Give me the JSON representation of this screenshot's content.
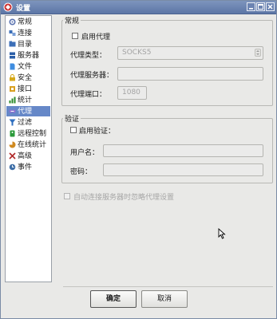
{
  "window": {
    "title": "设置"
  },
  "nav": {
    "items": [
      {
        "label": "常规",
        "icon": "gear-icon",
        "color": "#5a73b0"
      },
      {
        "label": "连接",
        "icon": "connection-icon",
        "color": "#3c6fb8"
      },
      {
        "label": "目录",
        "icon": "directory-icon",
        "color": "#3c6fb8"
      },
      {
        "label": "服务器",
        "icon": "server-icon",
        "color": "#2a5ea8"
      },
      {
        "label": "文件",
        "icon": "file-icon",
        "color": "#3f8de0"
      },
      {
        "label": "安全",
        "icon": "lock-icon",
        "color": "#d6a818"
      },
      {
        "label": "接口",
        "icon": "interface-icon",
        "color": "#d9a020"
      },
      {
        "label": "统计",
        "icon": "stats-icon",
        "color": "#2a8a2a"
      },
      {
        "label": "代理",
        "icon": "proxy-icon",
        "color": "#8e6fd0"
      },
      {
        "label": "过滤",
        "icon": "filter-icon",
        "color": "#3070c0"
      },
      {
        "label": "远程控制",
        "icon": "remote-control-icon",
        "color": "#2a9a3a"
      },
      {
        "label": "在线统计",
        "icon": "online-stats-icon",
        "color": "#d08a20"
      },
      {
        "label": "高级",
        "icon": "advanced-icon",
        "color": "#b02828"
      },
      {
        "label": "事件",
        "icon": "event-icon",
        "color": "#4070a8"
      }
    ],
    "selected_index": 8
  },
  "general": {
    "title": "常规",
    "enable_proxy": "启用代理",
    "proxy_type_label": "代理类型：",
    "proxy_type_value": "SOCKS5",
    "proxy_server_label": "代理服务器：",
    "proxy_server_value": "",
    "proxy_port_label": "代理端口：",
    "proxy_port_value": "1080"
  },
  "auth": {
    "title": "验证",
    "enable_auth": "启用验证：",
    "username_label": "用户名：",
    "username_value": "",
    "password_label": "密码：",
    "password_value": ""
  },
  "ignore_proxy_label": "自动连接服务器时忽略代理设置",
  "buttons": {
    "ok": "确定",
    "cancel": "取消"
  }
}
